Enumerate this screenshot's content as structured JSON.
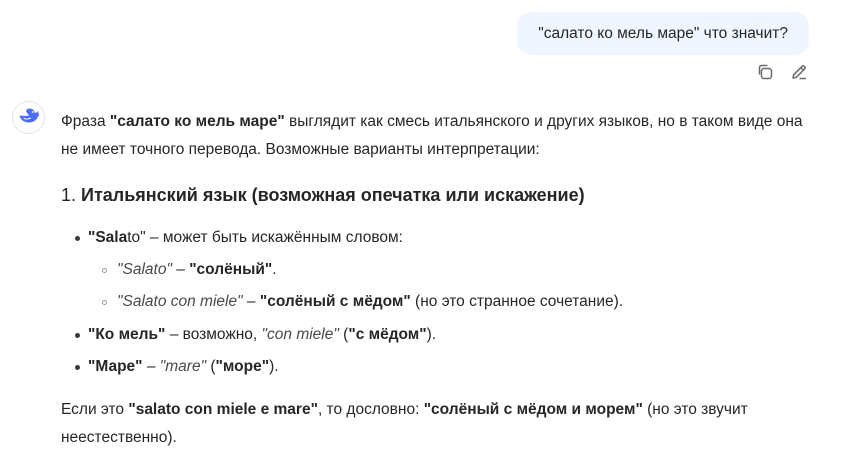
{
  "user_message": {
    "text": "\"салато ко мель маре\" что значит?"
  },
  "message_actions": {
    "copy_icon": "copy-icon",
    "edit_icon": "edit-icon"
  },
  "assistant": {
    "avatar_icon": "whale-logo-icon",
    "brand_color": "#4d6bfe",
    "intro": {
      "t1": "Фраза ",
      "phrase": "\"салато ко мель маре\"",
      "t2": " выглядит как смесь итальянского и других языков, но в таком виде она не имеет точного перевода. Возможные варианты интерпретации:"
    },
    "section1": {
      "number": "1.",
      "title": "Итальянский язык (возможная опечатка или искажение)"
    },
    "items": [
      {
        "bold": "\"Sala",
        "plain": "to\"",
        "rest": " – может быть искажённым словом:",
        "subitems": [
          {
            "italic": "\"Salato\"",
            "sep": " – ",
            "bold": "\"солёный\"",
            "rest": "."
          },
          {
            "italic": "\"Salato con miele\"",
            "sep": " – ",
            "bold": "\"солёный с мёдом\"",
            "rest": " (но это странное сочетание)."
          }
        ]
      },
      {
        "bold": "\"Ко мель\"",
        "rest1": " – возможно, ",
        "italic": "\"con miele\"",
        "rest2": " (",
        "bold2": "\"с мёдом\"",
        "rest3": ")."
      },
      {
        "bold": "\"Маре\"",
        "rest1": " – ",
        "italic": "\"mare\"",
        "rest2": " (",
        "bold2": "\"море\"",
        "rest3": ")."
      }
    ],
    "conclusion": {
      "t1": "Если это ",
      "bold1": "\"salato con miele e mare\"",
      "t2": ", то дословно: ",
      "bold2": "\"солёный с мёдом и морем\"",
      "t3": " (но это звучит неестественно)."
    }
  }
}
